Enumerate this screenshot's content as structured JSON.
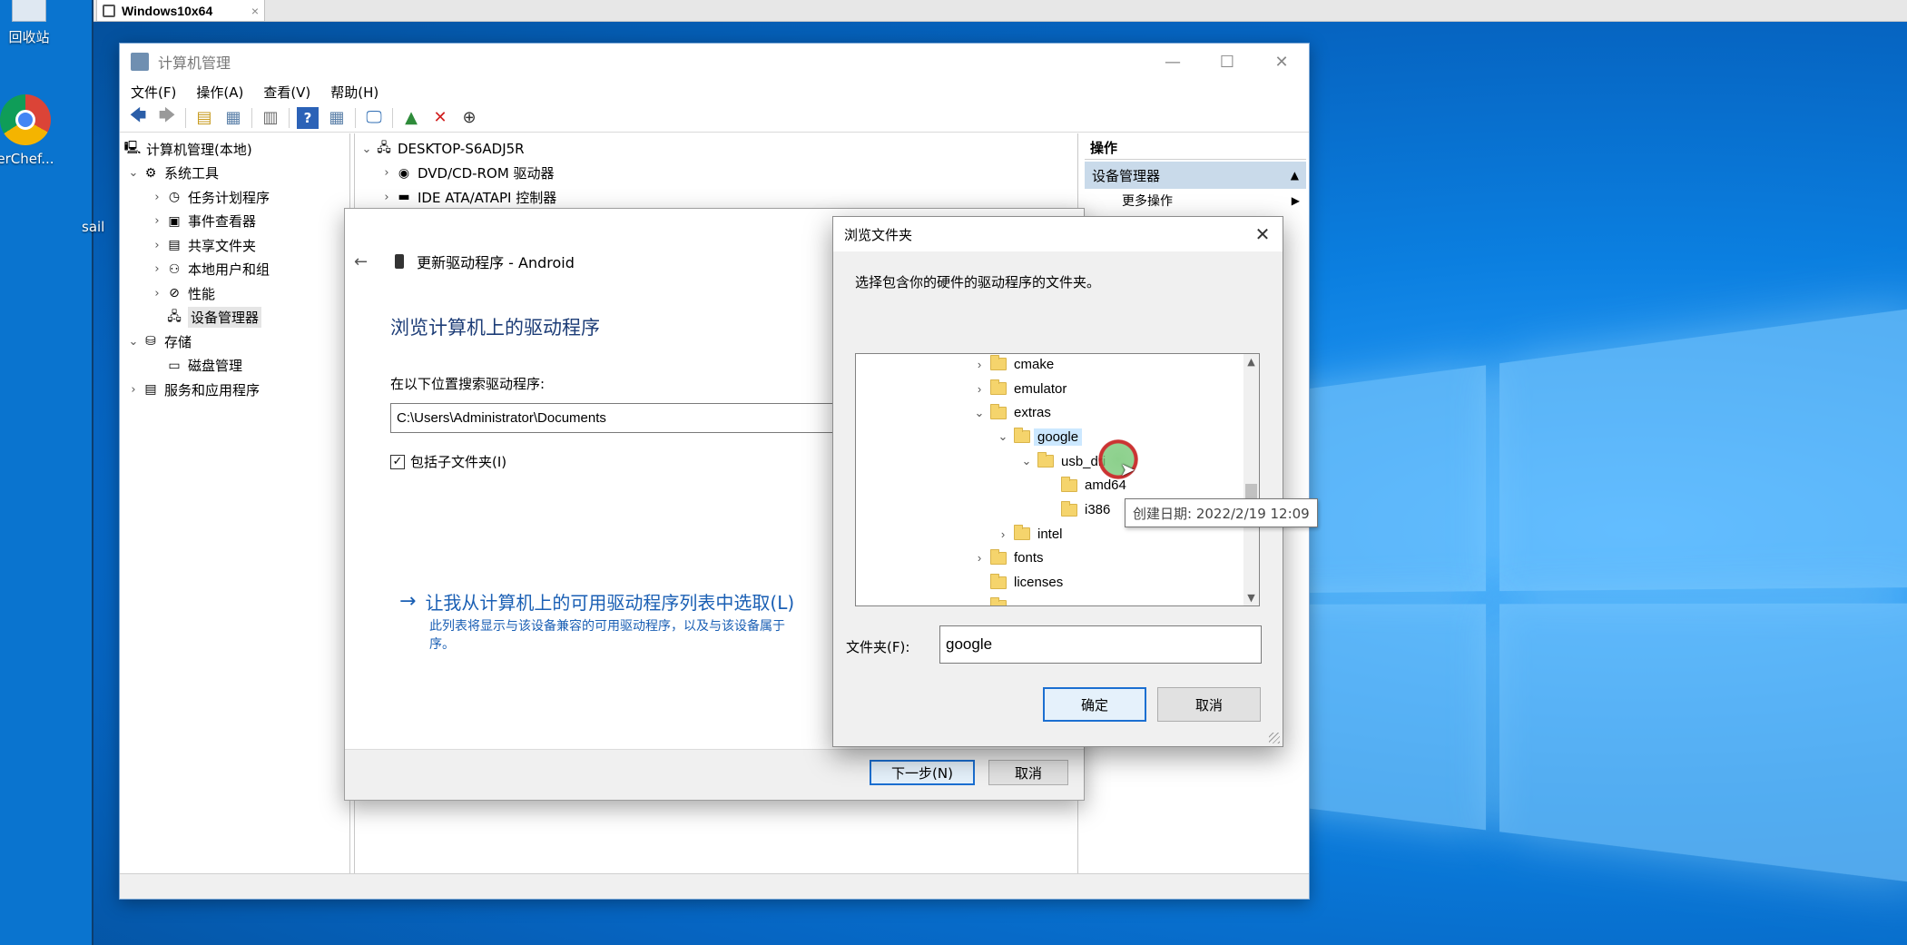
{
  "vm": {
    "tab_title": "Windows10x64",
    "tab_close": "×"
  },
  "desktop": {
    "icons": [
      {
        "label": "回收站"
      },
      {
        "label": "yberChef..."
      },
      {
        "label": "sail"
      }
    ]
  },
  "computer_management": {
    "title": "计算机管理",
    "caption_buttons": {
      "minimize": "—",
      "maximize": "☐",
      "close": "✕"
    },
    "menu": [
      "文件(F)",
      "操作(A)",
      "查看(V)",
      "帮助(H)"
    ],
    "toolbar_icons": [
      "back-arrow-icon",
      "forward-arrow-icon",
      "up-folder-icon",
      "console-tree-icon",
      "properties-icon",
      "help-icon",
      "show-pane-icon",
      "monitor-icon",
      "update-driver-icon",
      "uninstall-icon",
      "disable-device-icon"
    ],
    "tree": [
      {
        "label": "计算机管理(本地)",
        "indent": 0,
        "chevron": "",
        "icon": "computer-management-icon"
      },
      {
        "label": "系统工具",
        "indent": 1,
        "chevron": "⌄",
        "icon": "system-tools-icon"
      },
      {
        "label": "任务计划程序",
        "indent": 2,
        "chevron": "›",
        "icon": "task-scheduler-icon"
      },
      {
        "label": "事件查看器",
        "indent": 2,
        "chevron": "›",
        "icon": "event-viewer-icon"
      },
      {
        "label": "共享文件夹",
        "indent": 2,
        "chevron": "›",
        "icon": "shared-folders-icon"
      },
      {
        "label": "本地用户和组",
        "indent": 2,
        "chevron": "›",
        "icon": "local-users-icon"
      },
      {
        "label": "性能",
        "indent": 2,
        "chevron": "›",
        "icon": "performance-icon"
      },
      {
        "label": "设备管理器",
        "indent": 2,
        "chevron": "",
        "icon": "device-manager-icon",
        "selected": true
      },
      {
        "label": "存储",
        "indent": 1,
        "chevron": "⌄",
        "icon": "storage-icon"
      },
      {
        "label": "磁盘管理",
        "indent": 2,
        "chevron": "",
        "icon": "disk-management-icon"
      },
      {
        "label": "服务和应用程序",
        "indent": 1,
        "chevron": "›",
        "icon": "services-icon"
      }
    ],
    "device_tree": [
      {
        "label": "DESKTOP-S6ADJ5R",
        "chevron": "⌄",
        "indent": 0
      },
      {
        "label": "DVD/CD-ROM 驱动器",
        "chevron": "›",
        "indent": 1
      },
      {
        "label": "IDE ATA/ATAPI 控制器",
        "chevron": "›",
        "indent": 1
      }
    ],
    "actions": {
      "header": "操作",
      "sub_header": "设备管理器",
      "more": "更多操作"
    }
  },
  "wizard": {
    "back_icon": "←",
    "header": "更新驱动程序 - Android",
    "heading": "浏览计算机上的驱动程序",
    "search_label": "在以下位置搜索驱动程序:",
    "path_value": "C:\\Users\\Administrator\\Documents",
    "include_subfolders": "包括子文件夹(I)",
    "include_subfolders_checked": true,
    "pick_link": "让我从计算机上的可用驱动程序列表中选取(L)",
    "pick_desc_line1": "此列表将显示与该设备兼容的可用驱动程序，以及与该设备属于",
    "pick_desc_line2": "序。",
    "next_button": "下一步(N)",
    "cancel_button": "取消"
  },
  "browse_dialog": {
    "title": "浏览文件夹",
    "close": "✕",
    "prompt": "选择包含你的硬件的驱动程序的文件夹。",
    "folders": [
      {
        "label": "cmake",
        "depth": 0,
        "chevron": "›"
      },
      {
        "label": "emulator",
        "depth": 0,
        "chevron": "›"
      },
      {
        "label": "extras",
        "depth": 0,
        "chevron": "⌄"
      },
      {
        "label": "google",
        "depth": 1,
        "chevron": "⌄",
        "selected": true
      },
      {
        "label": "usb_dri",
        "depth": 2,
        "chevron": "⌄"
      },
      {
        "label": "amd64",
        "depth": 3,
        "chevron": ""
      },
      {
        "label": "i386",
        "depth": 3,
        "chevron": ""
      },
      {
        "label": "intel",
        "depth": 1,
        "chevron": "›"
      },
      {
        "label": "fonts",
        "depth": 0,
        "chevron": "›"
      },
      {
        "label": "licenses",
        "depth": 0,
        "chevron": ""
      }
    ],
    "tooltip": "创建日期: 2022/2/19 12:09",
    "folder_label": "文件夹(F):",
    "folder_value": "google",
    "ok_button": "确定",
    "cancel_button": "取消"
  }
}
